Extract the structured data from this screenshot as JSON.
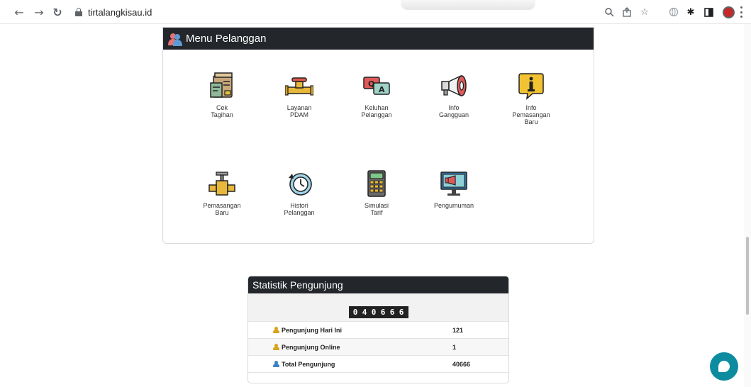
{
  "browser": {
    "url": "tirtalangkisau.id",
    "back_icon": "back-arrow-icon",
    "forward_icon": "forward-arrow-icon",
    "reload_icon": "reload-icon"
  },
  "menu": {
    "title": "Menu Pelanggan",
    "items": [
      {
        "label": "Cek\nTagihan",
        "icon": "bill-icon"
      },
      {
        "label": "Layanan\nPDAM",
        "icon": "pipe-valve-icon"
      },
      {
        "label": "Keluhan\nPelanggan",
        "icon": "qa-chat-icon"
      },
      {
        "label": "Info\nGangguan",
        "icon": "megaphone-icon"
      },
      {
        "label": "Info\nPemasangan\nBaru",
        "icon": "info-icon"
      },
      {
        "label": "Pemasangan\nBaru",
        "icon": "pipe-install-icon"
      },
      {
        "label": "Histori\nPelanggan",
        "icon": "history-icon"
      },
      {
        "label": "Simulasi\nTarif",
        "icon": "calculator-icon"
      },
      {
        "label": "Pengumuman",
        "icon": "announcement-monitor-icon"
      }
    ]
  },
  "stats": {
    "title": "Statistik Pengunjung",
    "counter_digits": [
      "0",
      "4",
      "0",
      "6",
      "6",
      "6"
    ],
    "rows": [
      {
        "label": "Pengunjung Hari Ini",
        "value": "121",
        "color": "#d9a21b"
      },
      {
        "label": "Pengunjung Online",
        "value": "1",
        "color": "#d9a21b"
      },
      {
        "label": "Total Pengunjung",
        "value": "40666",
        "color": "#3b7fc4"
      }
    ]
  },
  "colors": {
    "header_dark": "#23262b",
    "chat_accent": "#0d8ca0"
  }
}
